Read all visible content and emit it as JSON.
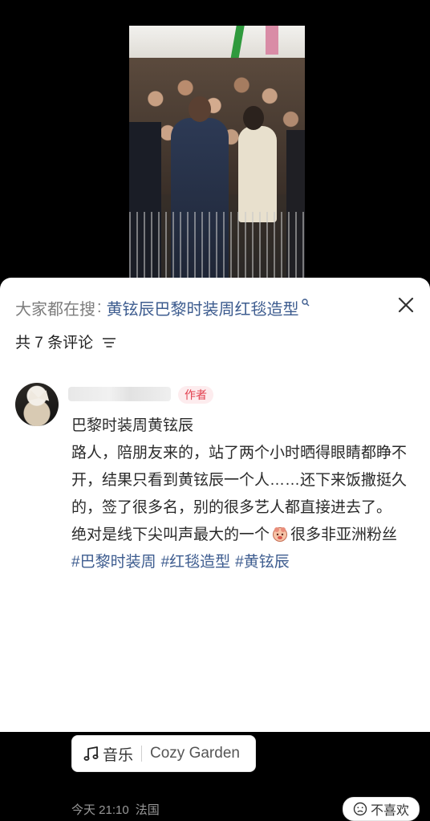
{
  "search": {
    "prefix": "大家都在搜",
    "colon": ":",
    "term": "黄铉辰巴黎时装周红毯造型"
  },
  "comments_header": {
    "count_text": "共 7 条评论"
  },
  "comment": {
    "author_badge": "作者",
    "paragraphs": [
      "巴黎时装周黄铉辰",
      "路人，陪朋友来的，站了两个小时晒得眼睛都睁不开，结果只看到黄铉辰一个人……还下来饭撒挺久的，签了很多名，别的很多艺人都直接进去了。"
    ],
    "last_before_emoji": "绝对是线下尖叫声最大的一个",
    "last_after_emoji": "很多非亚洲粉丝",
    "hashtags": [
      "#巴黎时装周",
      "#红毯造型",
      "#黄铉辰"
    ],
    "music": {
      "label": "音乐",
      "title": "Cozy Garden"
    },
    "time": "今天 21:10",
    "location": "法国",
    "dislike_label": "不喜欢"
  },
  "colors": {
    "link": "#3d5c8f",
    "badge_text": "#e2404f",
    "badge_bg": "#fdecee"
  },
  "icons": [
    "search-icon",
    "close-icon",
    "sort-icon",
    "music-note-icon",
    "sad-face-icon",
    "emoji-icon"
  ]
}
